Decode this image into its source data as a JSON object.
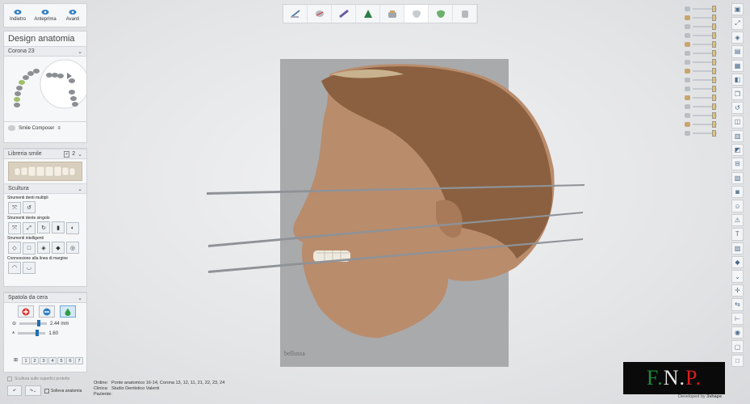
{
  "nav": {
    "back": "Indietro",
    "preview": "Anteprima",
    "next": "Avanti"
  },
  "panel": {
    "title": "Design anatomia",
    "crown_section": "Corona 23",
    "smile_composer": "Smile Composer",
    "library_section": "Libreria smile",
    "library_value": "2",
    "sculpt_section": "Scultura",
    "multi_tools_label": "Strumenti denti multipli",
    "single_tools_label": "Strumenti dente singolo",
    "smart_tools_label": "Strumenti intelligenti",
    "margin_label": "Connessione alla linea di margine",
    "wax_section": "Spatola da cera",
    "wax_size": "2.44 mm",
    "wax_strength": "1.60",
    "size_buttons": [
      "1",
      "2",
      "3",
      "4",
      "5",
      "6",
      "7"
    ],
    "protect_label": "Scultura sulle superfici protette",
    "lift_label": "Solleva anatomia"
  },
  "info": {
    "order_key": "Ordine:",
    "order_val": "Ponte anatomico 16-14, Corona 13, 12, 11, 21, 22, 23, 24",
    "clinic_key": "Clinica:",
    "clinic_val": "Studio Dentistico Valenti",
    "patient_key": "Paziente:",
    "patient_val": ""
  },
  "brand": {
    "letters": [
      "F.",
      "N.",
      "P."
    ],
    "colors": [
      "#1e8a3a",
      "#e8e8e8",
      "#d81e1e"
    ],
    "developed": "Developed by",
    "logo": "3shape"
  },
  "colors": {
    "accent": "#1f6fb5",
    "panel": "#f6f7f8"
  }
}
